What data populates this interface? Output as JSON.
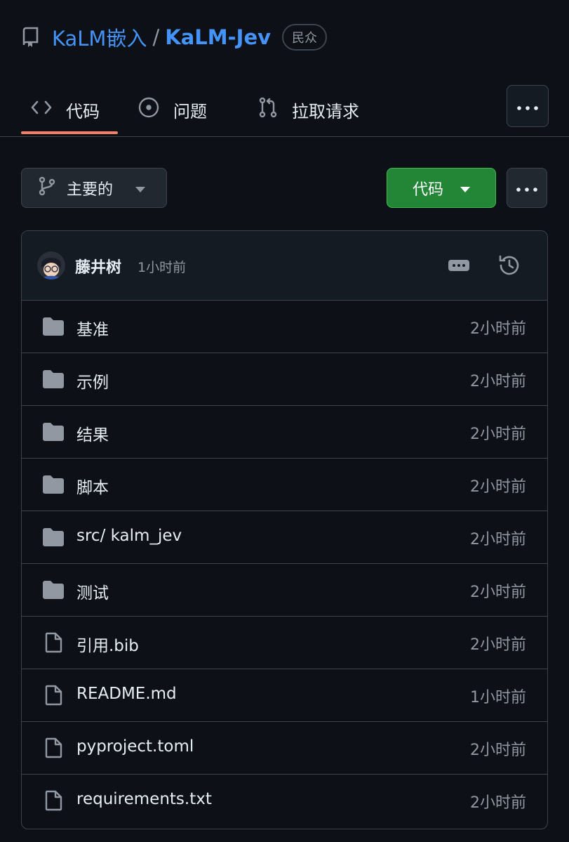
{
  "repo": {
    "owner": "KaLM嵌入",
    "separator": "/",
    "name": "KaLM-Jev",
    "visibility": "民众"
  },
  "tabs": [
    {
      "label": "代码",
      "icon": "code-icon",
      "selected": true
    },
    {
      "label": "问题",
      "icon": "issue-opened-icon"
    },
    {
      "label": "拉取请求",
      "icon": "pull-request-icon"
    }
  ],
  "toolbar": {
    "branch_label": "主要的",
    "code_button_label": "代码"
  },
  "latest_commit": {
    "author": "藤井树",
    "time": "1小时前"
  },
  "files": [
    {
      "type": "folder",
      "name": "基准",
      "time": "2小时前"
    },
    {
      "type": "folder",
      "name": "示例",
      "time": "2小时前"
    },
    {
      "type": "folder",
      "name": "结果",
      "time": "2小时前"
    },
    {
      "type": "folder",
      "name": "脚本",
      "time": "2小时前"
    },
    {
      "type": "folder",
      "name": "src/ kalm_jev",
      "time": "2小时前"
    },
    {
      "type": "folder",
      "name": "测试",
      "time": "2小时前"
    },
    {
      "type": "file",
      "name": "引用.bib",
      "time": "2小时前"
    },
    {
      "type": "file",
      "name": "README.md",
      "time": "1小时前"
    },
    {
      "type": "file",
      "name": "pyproject.toml",
      "time": "2小时前"
    },
    {
      "type": "file",
      "name": "requirements.txt",
      "time": "2小时前"
    }
  ],
  "colors": {
    "background": "#0d1117",
    "link": "#4493f8",
    "tab_underline": "#f78166",
    "code_button": "#238636",
    "muted_text": "#9198a1",
    "border": "#3d444d",
    "folder_icon": "#9198a1"
  }
}
